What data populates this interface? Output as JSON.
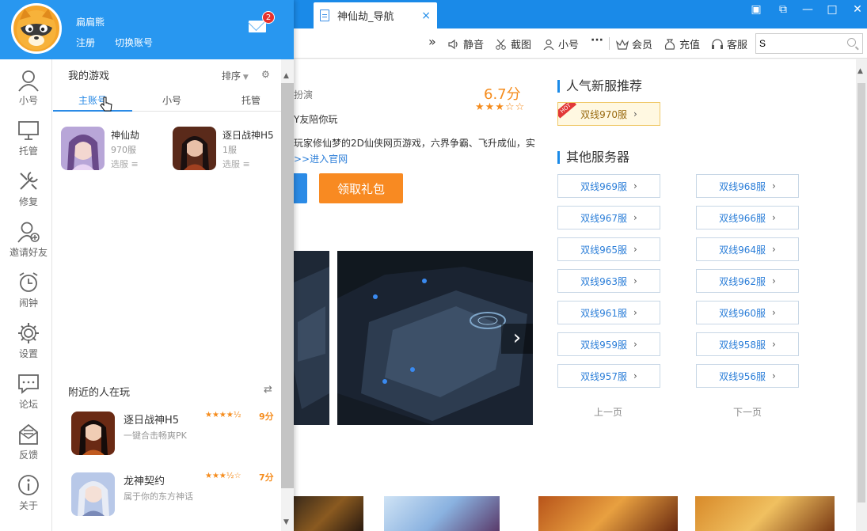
{
  "window": {
    "tab_title": "神仙劫_导航",
    "tab_close": "×",
    "controls": [
      "▣",
      "⧉",
      "—",
      "□",
      "✕"
    ]
  },
  "toolbar": {
    "more": "»",
    "mute": "静音",
    "screenshot": "截图",
    "alt_account": "小号",
    "dots": "···",
    "vip": "会员",
    "recharge": "充值",
    "service": "客服",
    "search_value": "S"
  },
  "panel": {
    "username": "扁扁熊",
    "register": "注册",
    "switch_account": "切换账号",
    "mail_count": "2",
    "nav": [
      {
        "label": "小号",
        "icon": "user-icon"
      },
      {
        "label": "托管",
        "icon": "monitor-icon"
      },
      {
        "label": "修复",
        "icon": "repair-icon"
      },
      {
        "label": "邀请好友",
        "icon": "invite-icon"
      },
      {
        "label": "闹钟",
        "icon": "alarm-icon"
      },
      {
        "label": "设置",
        "icon": "gear-icon"
      },
      {
        "label": "论坛",
        "icon": "forum-icon"
      },
      {
        "label": "反馈",
        "icon": "feedback-icon"
      },
      {
        "label": "关于",
        "icon": "info-icon"
      }
    ],
    "my_games": "我的游戏",
    "sort": "排序",
    "tabs": [
      "主账号",
      "小号",
      "托管"
    ],
    "games": [
      {
        "name": "神仙劫",
        "server": "970服",
        "select": "选服"
      },
      {
        "name": "逐日战神H5",
        "server": "1服",
        "select": "选服"
      }
    ],
    "nearby_title": "附近的人在玩",
    "nearby": [
      {
        "name": "逐日战神H5",
        "desc": "一键合击畅爽PK",
        "stars": "★★★★½",
        "score": "9分"
      },
      {
        "name": "龙神契约",
        "desc": "属于你的东方神话",
        "stars": "★★★½☆",
        "score": "7分"
      }
    ]
  },
  "main": {
    "intro_line1": "扮演",
    "intro_line2": "Y友陪你玩",
    "intro_line3": "玩家修仙梦的2D仙侠网页游戏，六界争霸、飞升成仙，实",
    "official_link": ">>进入官网",
    "rating": "6.7分",
    "rating_stars": "★★★☆☆",
    "gift_button": "领取礼包",
    "next_arrow": "›",
    "hot_title": "人气新服推荐",
    "hot_badge": "HOT",
    "hot_server": "双线970服",
    "other_title": "其他服务器",
    "servers_left": [
      "双线969服",
      "双线967服",
      "双线965服",
      "双线963服",
      "双线961服",
      "双线959服",
      "双线957服"
    ],
    "servers_right": [
      "双线968服",
      "双线966服",
      "双线964服",
      "双线962服",
      "双线960服",
      "双线958服",
      "双线956服"
    ],
    "prev_page": "上一页",
    "next_page": "下一页"
  },
  "colors": {
    "accent": "#2897f0",
    "orange": "#f88a22",
    "link": "#2b7ed8"
  }
}
